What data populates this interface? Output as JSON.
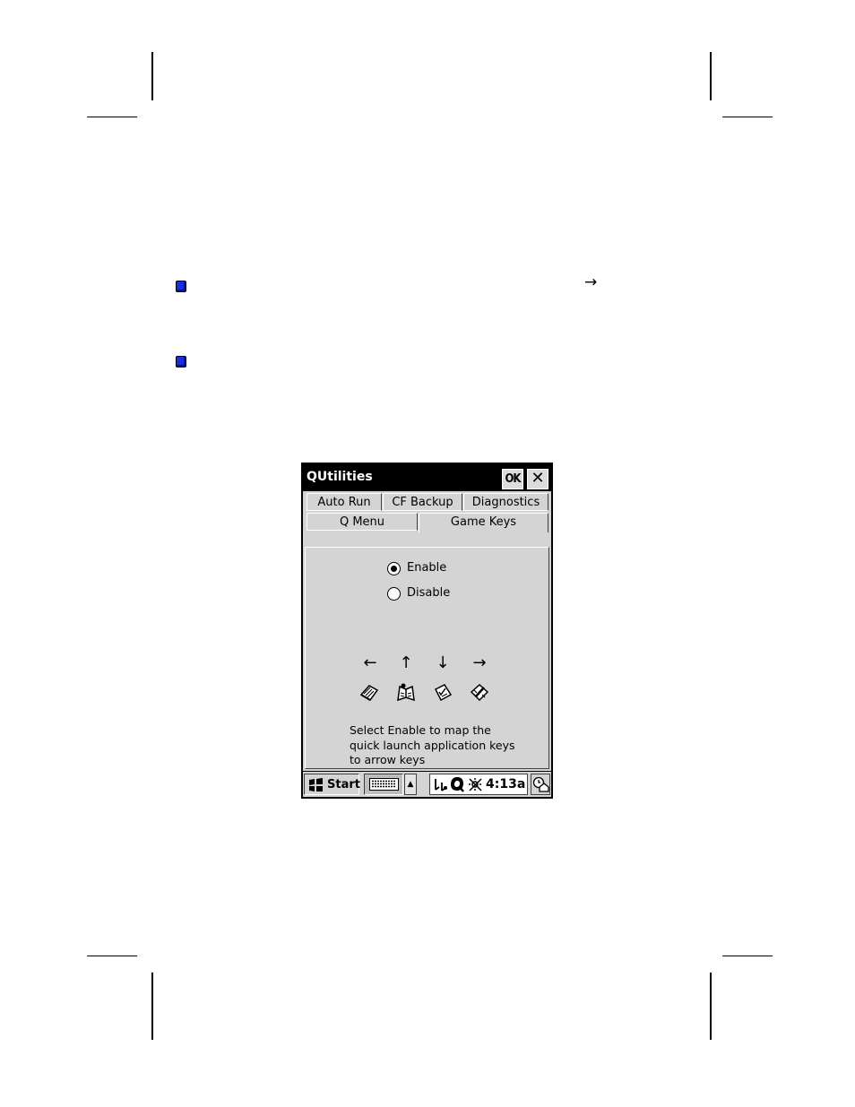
{
  "page": {
    "continuation_arrow": "→"
  },
  "window": {
    "title": "QUtilities",
    "ok_label": "OK",
    "close_label": "✕"
  },
  "tabs": {
    "row1": [
      "Auto Run",
      "CF Backup",
      "Diagnostics"
    ],
    "row2": [
      "Q Menu",
      "Game Keys"
    ],
    "active": "Game Keys"
  },
  "game_keys": {
    "options": [
      "Enable",
      "Disable"
    ],
    "selected": "Enable",
    "arrows": [
      "←",
      "↑",
      "↓",
      "→"
    ],
    "app_icons": [
      "contacts-app-icon",
      "calendar-app-icon",
      "tasks-app-icon",
      "notes-app-icon"
    ],
    "description": "Select Enable to map the\nquick launch application keys\nto arrow keys"
  },
  "taskbar": {
    "start_label": "Start",
    "keyboard_arrow": "▲",
    "clock": "4:13a"
  },
  "colors": {
    "bullet": "#1a2fd6",
    "window_face": "#d4d4d4",
    "titlebar": "#000000"
  }
}
